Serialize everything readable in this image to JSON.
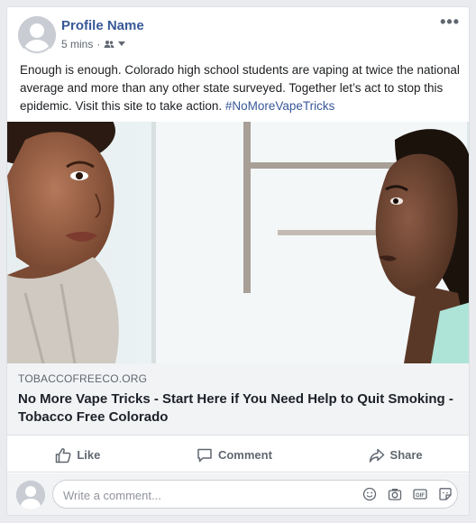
{
  "post": {
    "profile_name": "Profile Name",
    "time": "5 mins",
    "audience_icon": "friends-icon",
    "more_icon": "more-options-icon",
    "text": "Enough is enough. Colorado high school students are vaping at twice the national average and more than any other state surveyed. Together let’s act to stop this epidemic. Visit this site to take action.",
    "hashtag": "#NoMoreVapeTricks"
  },
  "link": {
    "domain": "TOBACCOFREECO.ORG",
    "title": "No More Vape Tricks - Start Here if You Need Help to Quit Smoking - Tobacco Free Colorado"
  },
  "actions": {
    "like": "Like",
    "comment": "Comment",
    "share": "Share"
  },
  "comment_box": {
    "placeholder": "Write a comment...",
    "icons": [
      "emoji-icon",
      "camera-icon",
      "gif-icon",
      "sticker-icon"
    ]
  },
  "colors": {
    "link_blue": "#385898",
    "page_bg": "#e9ebee",
    "muted_text": "#606770"
  }
}
